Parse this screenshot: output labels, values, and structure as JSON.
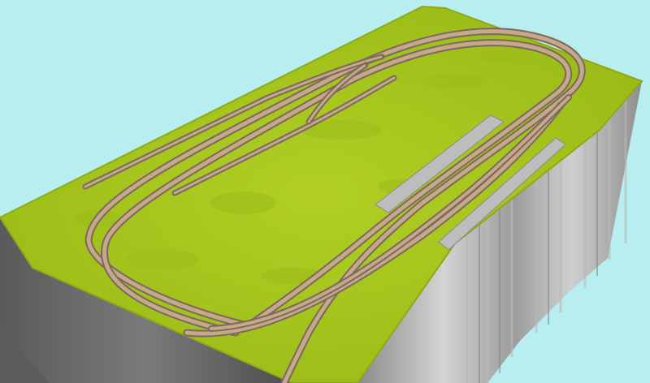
{
  "scene": {
    "description_free": true,
    "colors": {
      "sky": "#b8eef0",
      "grass": "#a8c81e",
      "grass_dark": "#8fae14",
      "cliff_light": "#c8c8c8",
      "cliff_dark": "#6e6e6e",
      "platform": "#b0b0b0",
      "rail": "#c9a98a",
      "sleeper": "#6a4a3c",
      "ballast": "#9a8a80"
    },
    "icons": [
      "track-rail",
      "station-platform",
      "terrain-board"
    ]
  }
}
